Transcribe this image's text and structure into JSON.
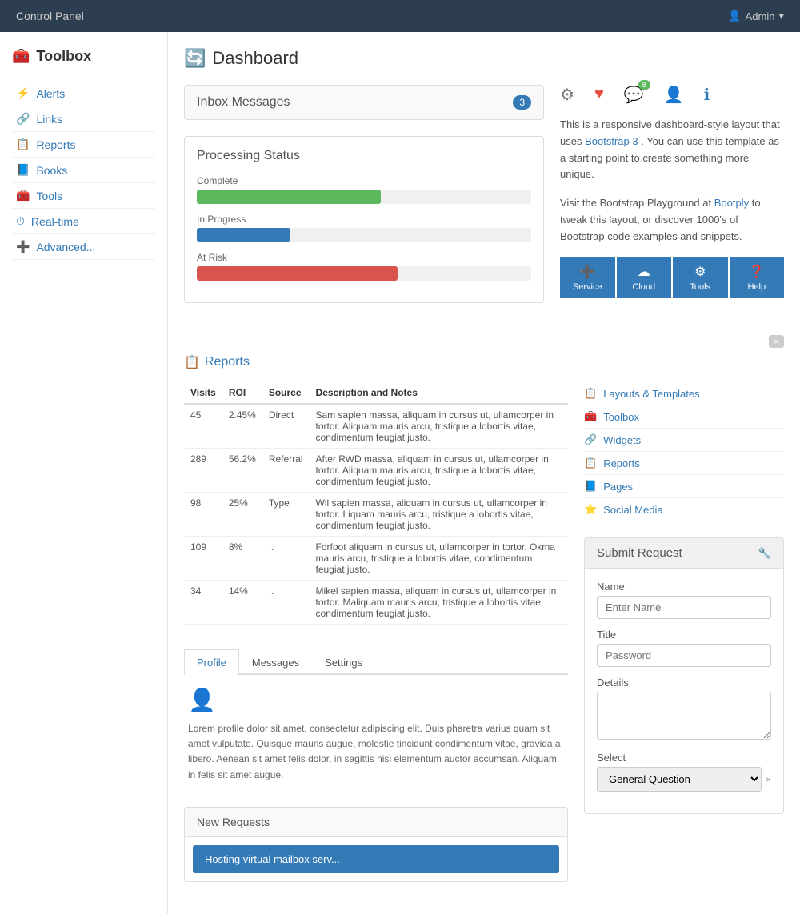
{
  "navbar": {
    "brand": "Control Panel",
    "admin_label": "Admin",
    "admin_arrow": "▾"
  },
  "sidebar": {
    "title": "Toolbox",
    "title_icon": "🧰",
    "items": [
      {
        "id": "alerts",
        "icon": "⚡",
        "label": "Alerts"
      },
      {
        "id": "links",
        "icon": "🔗",
        "label": "Links"
      },
      {
        "id": "reports",
        "icon": "📋",
        "label": "Reports"
      },
      {
        "id": "books",
        "icon": "📘",
        "label": "Books"
      },
      {
        "id": "tools",
        "icon": "🧰",
        "label": "Tools"
      },
      {
        "id": "realtime",
        "icon": "⏱",
        "label": "Real-time"
      },
      {
        "id": "advanced",
        "icon": "➕",
        "label": "Advanced..."
      }
    ]
  },
  "dashboard": {
    "title": "Dashboard",
    "title_icon": "🔄"
  },
  "inbox": {
    "label": "Inbox Messages",
    "count": "3"
  },
  "icon_row": {
    "gear": "⚙",
    "heart": "♥",
    "chat": "💬",
    "chat_badge": "8",
    "user": "👤",
    "info": "ℹ"
  },
  "description": {
    "text1": "This is a responsive dashboard-style layout that uses",
    "link1": "Bootstrap 3",
    "text2": ". You can use this template as a starting point to create something more unique.",
    "text3": "Visit the Bootstrap Playground at",
    "link2": "Bootply",
    "text4": " to tweak this layout, or discover 1000's of Bootstrap code examples and snippets."
  },
  "action_buttons": [
    {
      "icon": "➕",
      "label": "Service"
    },
    {
      "icon": "☁",
      "label": "Cloud"
    },
    {
      "icon": "⚙",
      "label": "Tools"
    },
    {
      "icon": "❓",
      "label": "Help"
    }
  ],
  "processing": {
    "title": "Processing Status",
    "items": [
      {
        "label": "Complete",
        "color": "green",
        "width": "55%"
      },
      {
        "label": "In Progress",
        "color": "blue",
        "width": "28%"
      },
      {
        "label": "At Risk",
        "color": "red",
        "width": "60%"
      }
    ]
  },
  "reports_section": {
    "title": "Reports",
    "title_icon": "📋"
  },
  "reports_table": {
    "headers": [
      "Visits",
      "ROI",
      "Source",
      "Description and Notes"
    ],
    "rows": [
      {
        "visits": "45",
        "roi": "2.45%",
        "source": "Direct",
        "desc": "Sam sapien massa, aliquam in cursus ut, ullamcorper in tortor. Aliquam mauris arcu, tristique a lobortis vitae, condimentum feugiat justo."
      },
      {
        "visits": "289",
        "roi": "56.2%",
        "source": "Referral",
        "desc": "After RWD massa, aliquam in cursus ut, ullamcorper in tortor. Aliquam mauris arcu, tristique a lobortis vitae, condimentum feugiat justo."
      },
      {
        "visits": "98",
        "roi": "25%",
        "source": "Type",
        "desc": "Wil sapien massa, aliquam in cursus ut, ullamcorper in tortor. Liquam mauris arcu, tristique a lobortis vitae, condimentum feugiat justo."
      },
      {
        "visits": "109",
        "roi": "8%",
        "source": "..",
        "desc": "Forfoot aliquam in cursus ut, ullamcorper in tortor. Okma mauris arcu, tristique a lobortis vitae, condimentum feugiat justo."
      },
      {
        "visits": "34",
        "roi": "14%",
        "source": "..",
        "desc": "Mikel sapien massa, aliquam in cursus ut, ullamcorper in tortor. Maliquam mauris arcu, tristique a lobortis vitae, condimentum feugiat justo."
      }
    ]
  },
  "right_links": [
    {
      "icon": "📋",
      "label": "Layouts & Templates"
    },
    {
      "icon": "🧰",
      "label": "Toolbox"
    },
    {
      "icon": "🔗",
      "label": "Widgets"
    },
    {
      "icon": "📋",
      "label": "Reports"
    },
    {
      "icon": "📘",
      "label": "Pages"
    },
    {
      "icon": "⭐",
      "label": "Social Media"
    }
  ],
  "tabs": {
    "items": [
      {
        "id": "profile",
        "label": "Profile",
        "active": true
      },
      {
        "id": "messages",
        "label": "Messages",
        "active": false
      },
      {
        "id": "settings",
        "label": "Settings",
        "active": false
      }
    ],
    "profile_text": "Lorem profile dolor sit amet, consectetur adipiscing elit. Duis pharetra varius quam sit amet vulputate. Quisque mauris augue, molestie tincidunt condimentum vitae, gravida a libero. Aenean sit amet felis dolor, in sagittis nisi elementum auctor accumsan. Aliquam in felis sit amet augue."
  },
  "new_requests": {
    "title": "New Requests",
    "item": "Hosting virtual mailbox serv..."
  },
  "submit_request": {
    "title": "Submit Request",
    "wrench_icon": "🔧",
    "name_label": "Name",
    "name_placeholder": "Enter Name",
    "title_label": "Title",
    "title_placeholder": "Password",
    "details_label": "Details",
    "select_label": "Select",
    "select_value": "General Question",
    "select_clear": "×"
  }
}
